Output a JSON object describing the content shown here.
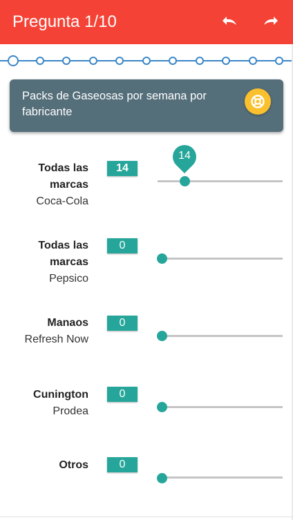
{
  "header": {
    "title": "Pregunta 1/10",
    "undo_icon": "undo-icon",
    "redo_icon": "redo-icon",
    "color": "#f44336"
  },
  "progress": {
    "total_steps": 11,
    "current_step": 1,
    "color": "#3a86c8"
  },
  "question": {
    "text": "Packs de Gaseosas por semana por fabricante",
    "help_icon": "lifebuoy-icon",
    "background": "#546e7a",
    "help_color": "#fbc02d"
  },
  "sliders": [
    {
      "brand": "Todas las marcas",
      "maker": "Coca-Cola",
      "value": "14",
      "fraction": 0.22,
      "show_pin": true
    },
    {
      "brand": "Todas las marcas",
      "maker": "Pepsico",
      "value": "0",
      "fraction": 0,
      "show_pin": false
    },
    {
      "brand": "Manaos",
      "maker": "Refresh Now",
      "value": "0",
      "fraction": 0,
      "show_pin": false
    },
    {
      "brand": "Cunington",
      "maker": "Prodea",
      "value": "0",
      "fraction": 0,
      "show_pin": false
    },
    {
      "brand": "Otros",
      "maker": "",
      "value": "0",
      "fraction": 0,
      "show_pin": false
    }
  ],
  "accent_color": "#26a69a"
}
